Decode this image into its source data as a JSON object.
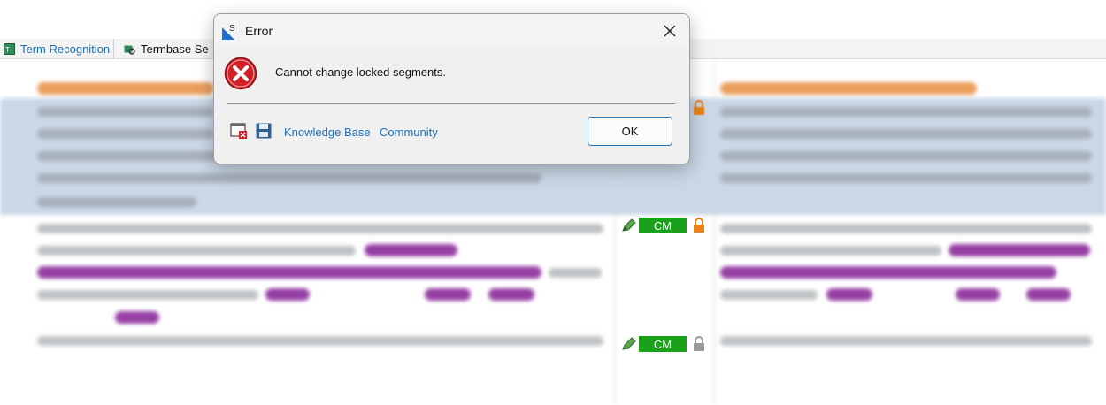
{
  "tabs": [
    {
      "label": "Term Recognition",
      "icon": "term-recognition-icon"
    },
    {
      "label": "Termbase Se",
      "icon": "termbase-search-icon"
    }
  ],
  "segments": [
    {
      "status": "CM",
      "locked": true
    },
    {
      "status": "CM",
      "locked": true
    }
  ],
  "dialog": {
    "title": "Error",
    "message": "Cannot change locked segments.",
    "links": [
      "Knowledge Base",
      "Community"
    ],
    "ok_label": "OK"
  },
  "colors": {
    "link": "#1f6fb8",
    "error_red": "#d21f26",
    "status_green": "#1aa01a",
    "lock_orange": "#e8821a",
    "selection_blue": "#c9d7e6"
  }
}
